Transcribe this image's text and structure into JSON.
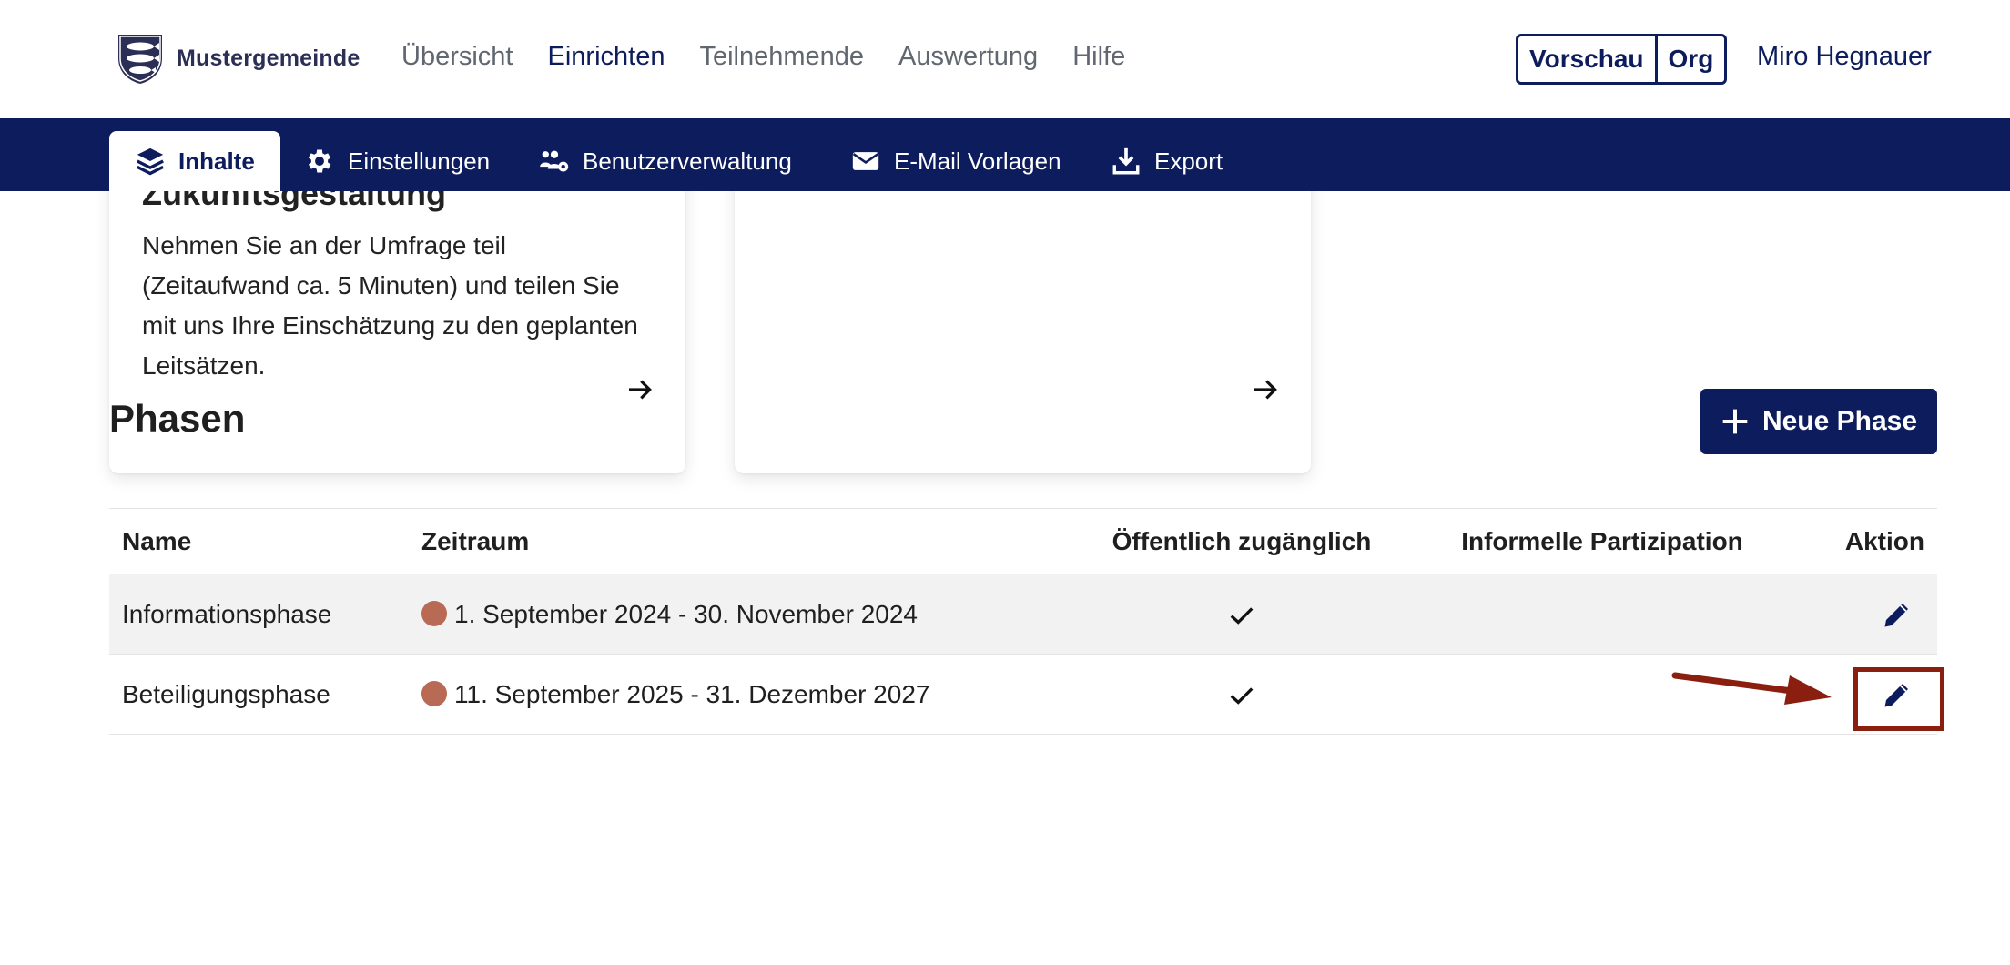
{
  "header": {
    "logo_text": "Mustergemeinde",
    "nav": [
      {
        "label": "Übersicht",
        "active": false
      },
      {
        "label": "Einrichten",
        "active": true
      },
      {
        "label": "Teilnehmende",
        "active": false
      },
      {
        "label": "Auswertung",
        "active": false
      },
      {
        "label": "Hilfe",
        "active": false
      }
    ],
    "preview_label": "Vorschau",
    "org_label": "Org",
    "user_name": "Miro Hegnauer"
  },
  "subnav": {
    "items": [
      {
        "label": "Inhalte",
        "icon": "layers-icon",
        "active": true
      },
      {
        "label": "Einstellungen",
        "icon": "gear-icon",
        "active": false
      },
      {
        "label": "Benutzerverwaltung",
        "icon": "users-gear-icon",
        "active": false
      },
      {
        "label": "E-Mail Vorlagen",
        "icon": "envelope-icon",
        "active": false
      },
      {
        "label": "Export",
        "icon": "download-icon",
        "active": false
      }
    ]
  },
  "cards": [
    {
      "title": "Zukunftsgestaltung",
      "text": "Nehmen Sie an der Umfrage teil (Zeitaufwand ca. 5 Minuten) und teilen Sie mit uns Ihre Einschätzung zu den geplanten Leitsätzen."
    },
    {
      "title": "",
      "text": ""
    }
  ],
  "phasen": {
    "title": "Phasen",
    "new_button": "Neue Phase",
    "columns": [
      "Name",
      "Zeitraum",
      "Öffentlich zugänglich",
      "Informelle Partizipation",
      "Aktion"
    ],
    "rows": [
      {
        "name": "Informationsphase",
        "zeitraum": "1. September 2024 - 30. November 2024",
        "oeffentlich": true,
        "informell": false
      },
      {
        "name": "Beteiligungsphase",
        "zeitraum": "11. September 2025 - 31. Dezember 2027",
        "oeffentlich": true,
        "informell": false
      }
    ]
  },
  "colors": {
    "brand": "#0d1c5d",
    "status_dot": "#b96a54",
    "annotation": "#8a1f10"
  }
}
